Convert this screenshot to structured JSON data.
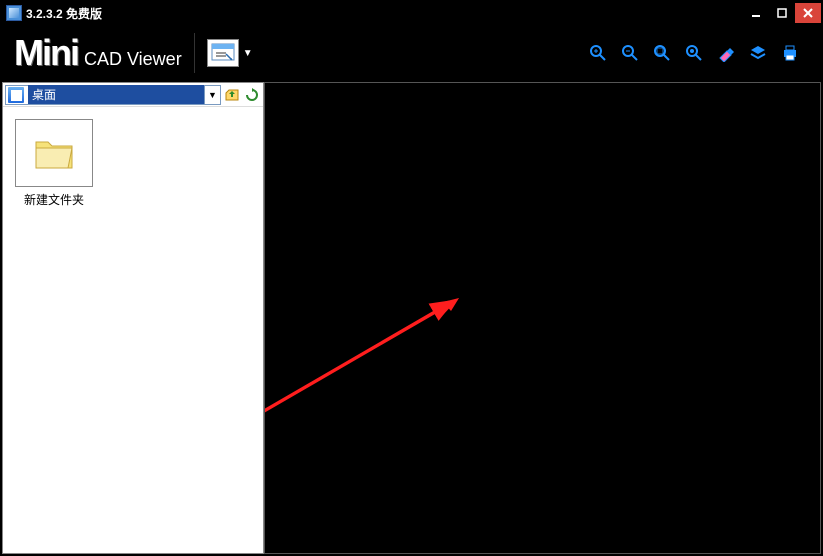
{
  "title": "3.2.3.2 免费版",
  "logo": {
    "main": "Mini",
    "sub": "CAD Viewer"
  },
  "toolbar": {
    "main_button": "select-document",
    "right_tools": [
      "zoom-in",
      "zoom-out",
      "zoom-fit",
      "zoom-window",
      "erase",
      "layers",
      "print"
    ]
  },
  "sidebar": {
    "location_label": "桌面",
    "items": [
      {
        "name": "新建文件夹"
      }
    ]
  },
  "colors": {
    "accent": "#1e90ff",
    "close": "#d9443a",
    "arrow": "#ff1e1e"
  }
}
